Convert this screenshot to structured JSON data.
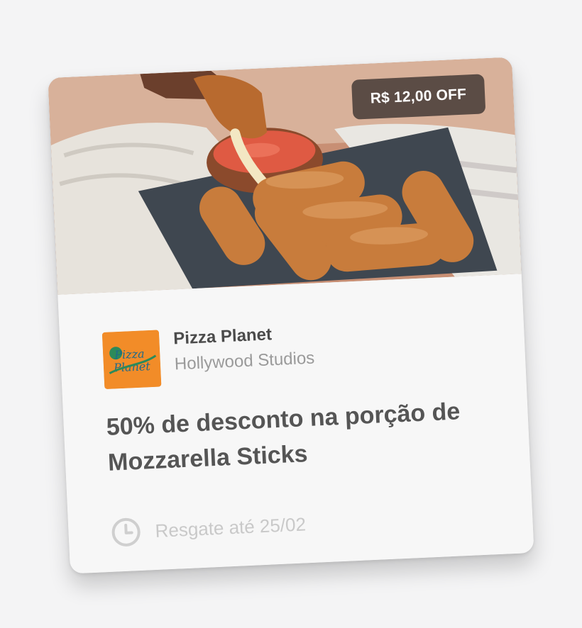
{
  "offer": {
    "discount_badge": "R$ 12,00 OFF",
    "title": "50% de desconto na porção de Mozzarella Sticks",
    "redeem_text": "Resgate até 25/02"
  },
  "merchant": {
    "name": "Pizza Planet",
    "location": "Hollywood Studios",
    "logo_text": [
      "Pizza",
      "Planet"
    ]
  },
  "icons": {
    "clock": "clock-icon"
  },
  "colors": {
    "badge_bg": "#5b4c45",
    "logo_bg": "#f28c28",
    "text_primary": "#555555",
    "text_muted": "#c9c9c9"
  }
}
